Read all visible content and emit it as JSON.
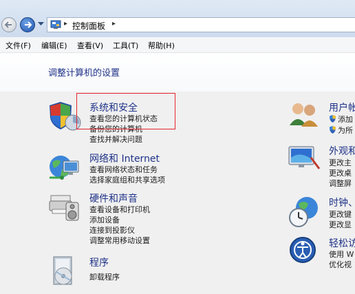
{
  "address_bar": {
    "breadcrumb": "控制面板",
    "separator": "▸"
  },
  "menu": [
    "文件(F)",
    "编辑(E)",
    "查看(V)",
    "工具(T)",
    "帮助(H)"
  ],
  "header_title": "调整计算机的设置",
  "categories_left": [
    {
      "title": "系统和安全",
      "links": [
        "查看您的计算机状态",
        "备份您的计算机",
        "查找并解决问题"
      ],
      "icon": "system-security-icon"
    },
    {
      "title": "网络和 Internet",
      "links": [
        "查看网络状态和任务",
        "选择家庭组和共享选项"
      ],
      "icon": "network-icon"
    },
    {
      "title": "硬件和声音",
      "links": [
        "查看设备和打印机",
        "添加设备",
        "连接到投影仪",
        "调整常用移动设置"
      ],
      "icon": "hardware-sound-icon"
    },
    {
      "title": "程序",
      "links": [
        "卸载程序"
      ],
      "icon": "programs-icon"
    }
  ],
  "categories_right": [
    {
      "title": "用户帐",
      "links": [
        "添加",
        "为所"
      ],
      "icon": "user-accounts-icon"
    },
    {
      "title": "外观和",
      "links": [
        "更改主",
        "更改桌",
        "调整屏"
      ],
      "icon": "appearance-icon"
    },
    {
      "title": "时钟、",
      "links": [
        "更改键",
        "更改显"
      ],
      "icon": "clock-region-icon"
    },
    {
      "title": "轻松访",
      "links": [
        "使用 W",
        "优化视"
      ],
      "icon": "ease-of-access-icon"
    }
  ]
}
